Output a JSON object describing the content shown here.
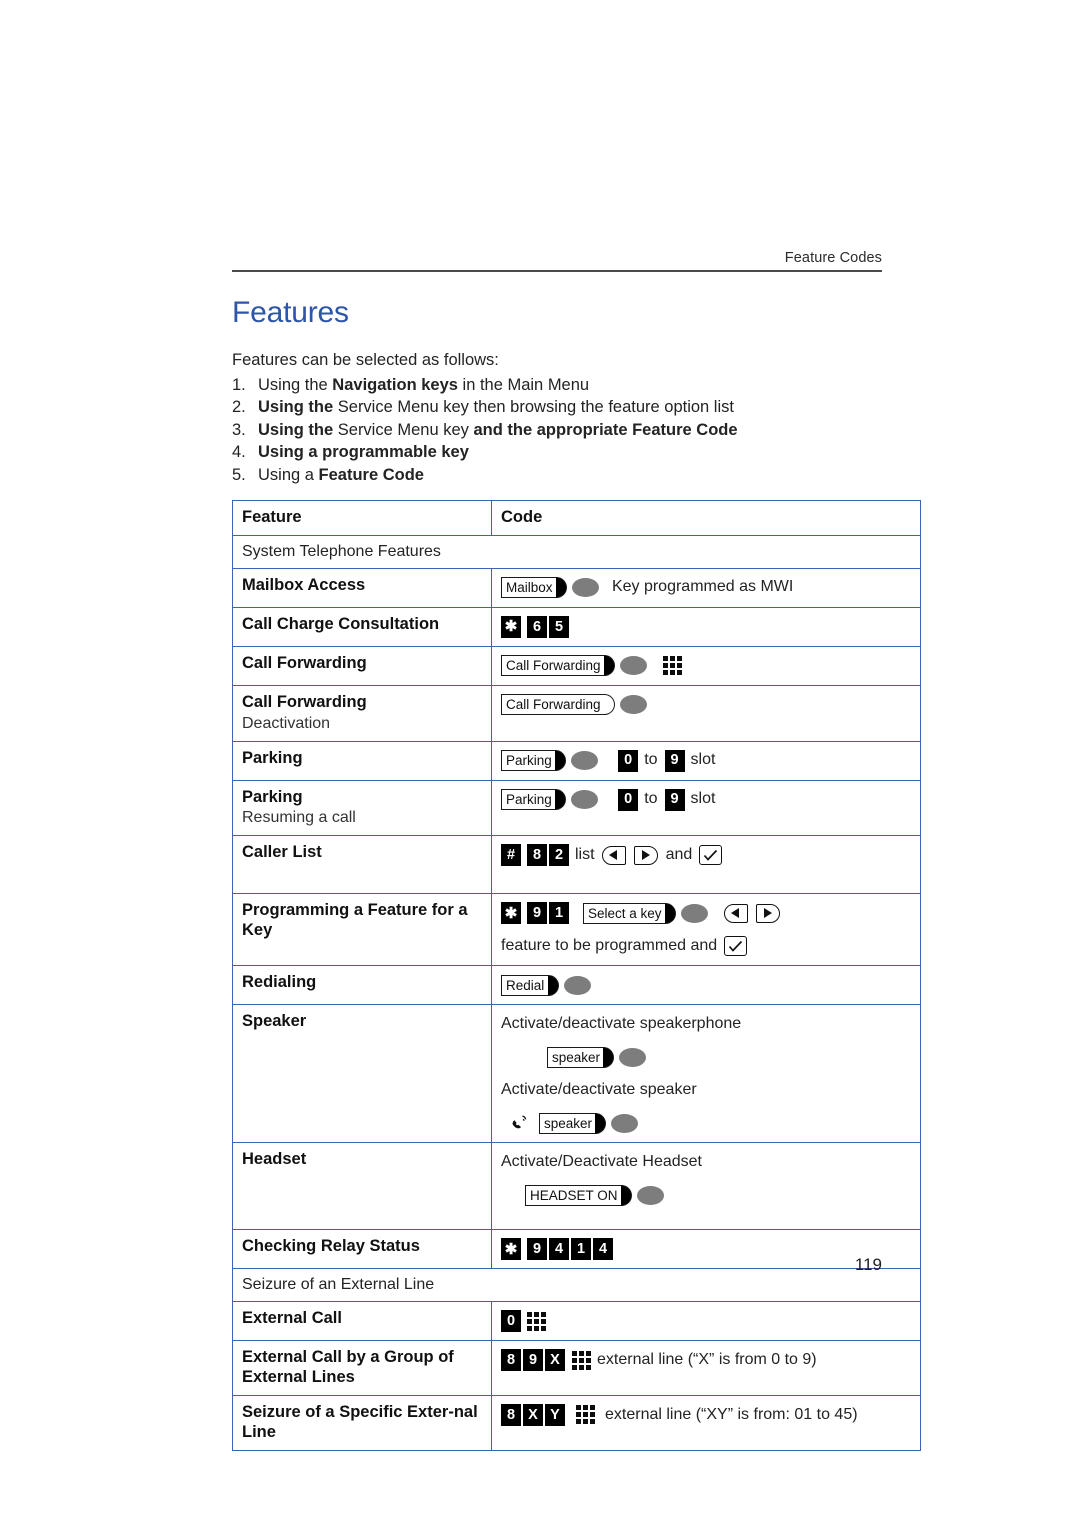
{
  "page": {
    "running_header": "Feature Codes",
    "page_number": "119"
  },
  "title": "Features",
  "intro": {
    "lead": "Features can be selected as follows:",
    "steps": [
      {
        "num": "1.",
        "parts": [
          {
            "t": "Using the ",
            "b": false
          },
          {
            "t": "Navigation keys",
            "b": true
          },
          {
            "t": " in the Main Menu",
            "b": false
          }
        ]
      },
      {
        "num": "2.",
        "parts": [
          {
            "t": "Using the",
            "b": true
          },
          {
            "t": " Service Menu key then browsing the feature option list",
            "b": false
          }
        ]
      },
      {
        "num": "3.",
        "parts": [
          {
            "t": "Using the",
            "b": true
          },
          {
            "t": " Service Menu key ",
            "b": false
          },
          {
            "t": "and the appropriate Feature Code",
            "b": true
          }
        ]
      },
      {
        "num": "4.",
        "parts": [
          {
            "t": "Using a programmable key",
            "b": true
          }
        ]
      },
      {
        "num": "5.",
        "parts": [
          {
            "t": "Using a ",
            "b": false
          },
          {
            "t": "Feature Code",
            "b": true
          }
        ]
      }
    ]
  },
  "table": {
    "header": {
      "feature": "Feature",
      "code": "Code"
    },
    "sections": [
      {
        "heading": "System Telephone Features"
      },
      {
        "heading": "Seizure of an External Line"
      }
    ],
    "rows": [
      {
        "feature": "Mailbox Access",
        "sub": "",
        "key_label": "Mailbox",
        "note": "Key programmed as MWI"
      },
      {
        "feature": "Call Charge Consultation",
        "sub": "",
        "keys": [
          "✱",
          "6",
          "5"
        ]
      },
      {
        "feature": "Call Forwarding",
        "sub": "",
        "key_label": "Call Forwarding"
      },
      {
        "feature": "Call Forwarding",
        "sub": "Deactivation",
        "key_label": "Call Forwarding"
      },
      {
        "feature": "Parking",
        "sub": "",
        "key_label": "Parking",
        "from_key": "0",
        "to_word": "to",
        "to_key": "9",
        "slot_word": "slot"
      },
      {
        "feature": "Parking",
        "sub": "Resuming a call",
        "key_label": "Parking",
        "from_key": "0",
        "to_word": "to",
        "to_key": "9",
        "slot_word": "slot"
      },
      {
        "feature": "Caller List",
        "sub": "",
        "keys": [
          "#",
          "8",
          "2"
        ],
        "list_word": "list",
        "and_word": "and"
      },
      {
        "feature": "Programming a Feature for a Key",
        "sub": "",
        "keys": [
          "✱",
          "9",
          "1"
        ],
        "key_label": "Select a key",
        "line2": "feature to be programmed and"
      },
      {
        "feature": "Redialing",
        "sub": "",
        "key_label": "Redial"
      },
      {
        "feature": "Speaker",
        "sub": "",
        "line1": "Activate/deactivate speakerphone",
        "key_label_1": "speaker",
        "line2": "Activate/deactivate speaker",
        "key_label_2": "speaker"
      },
      {
        "feature": "Headset",
        "sub": "",
        "line1": "Activate/Deactivate Headset",
        "key_label": "HEADSET ON"
      },
      {
        "feature": "Checking Relay Status",
        "sub": "",
        "keys": [
          "✱",
          "9",
          "4",
          "1",
          "4"
        ]
      },
      {
        "feature": "External Call",
        "sub": "",
        "keys": [
          "0"
        ]
      },
      {
        "feature": "External Call by a Group of External Lines",
        "sub": "",
        "keys": [
          "8",
          "9",
          "X"
        ],
        "note": "external line (“X” is from 0 to 9)"
      },
      {
        "feature": "Seizure of a Specific Exter-nal Line",
        "sub": "",
        "keys": [
          "8",
          "X",
          "Y"
        ],
        "note": "external line (“XY” is from: 01 to 45)"
      }
    ]
  },
  "colors": {
    "heading_blue": "#2d55a8",
    "table_border_blue": "#3a62b5",
    "key_black": "#000000",
    "led_gray": "#7d7d7d"
  },
  "icons": {
    "dialpad": "dialpad-icon",
    "nav_left": "nav-left-icon",
    "nav_right": "nav-right-icon",
    "check": "check-icon",
    "handset": "handset-icon"
  }
}
